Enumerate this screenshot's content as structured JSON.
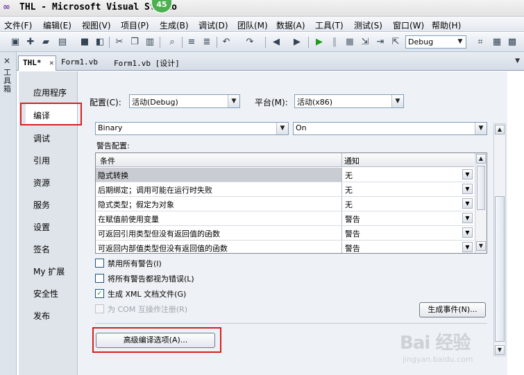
{
  "window": {
    "title": "THL - Microsoft Visual Studio",
    "badge": "45"
  },
  "menu": [
    "文件(F)",
    "编辑(E)",
    "视图(V)",
    "项目(P)",
    "生成(B)",
    "调试(D)",
    "团队(M)",
    "数据(A)",
    "工具(T)",
    "测试(S)",
    "窗口(W)",
    "帮助(H)"
  ],
  "toolbar": {
    "config_combo": "Debug"
  },
  "side_panel": {
    "label": "工具箱"
  },
  "tabs": [
    {
      "label": "THL*"
    },
    {
      "label": "Form1.vb"
    },
    {
      "label": "Form1.vb [设计]"
    }
  ],
  "nav": [
    "应用程序",
    "编译",
    "调试",
    "引用",
    "资源",
    "服务",
    "设置",
    "签名",
    "My 扩展",
    "安全性",
    "发布"
  ],
  "config": {
    "label": "配置(C):",
    "value": "活动(Debug)"
  },
  "platform": {
    "label": "平台(M):",
    "value": "活动(x86)"
  },
  "option_combos": {
    "left": "Binary",
    "right": "On"
  },
  "warnings": {
    "title": "警告配置:",
    "col_condition": "条件",
    "col_notify": "通知",
    "rows": [
      {
        "condition": "隐式转换",
        "notify": "无"
      },
      {
        "condition": "后期绑定；调用可能在运行时失败",
        "notify": "无"
      },
      {
        "condition": "隐式类型；假定为对象",
        "notify": "无"
      },
      {
        "condition": "在赋值前使用变量",
        "notify": "警告"
      },
      {
        "condition": "可返回引用类型但没有返回值的函数",
        "notify": "警告"
      },
      {
        "condition": "可返回内部值类型但没有返回值的函数",
        "notify": "警告"
      }
    ]
  },
  "checkboxes": [
    {
      "label": "禁用所有警告(I)",
      "checked": false,
      "enabled": true
    },
    {
      "label": "将所有警告都视为错误(L)",
      "checked": false,
      "enabled": true
    },
    {
      "label": "生成 XML 文档文件(G)",
      "checked": true,
      "enabled": true
    },
    {
      "label": "为 COM 互操作注册(R)",
      "checked": false,
      "enabled": false
    }
  ],
  "buttons": {
    "build_events": "生成事件(N)...",
    "advanced": "高级编译选项(A)..."
  },
  "watermark": {
    "main": "Bai 经验",
    "sub": "jingyan.baidu.com"
  }
}
